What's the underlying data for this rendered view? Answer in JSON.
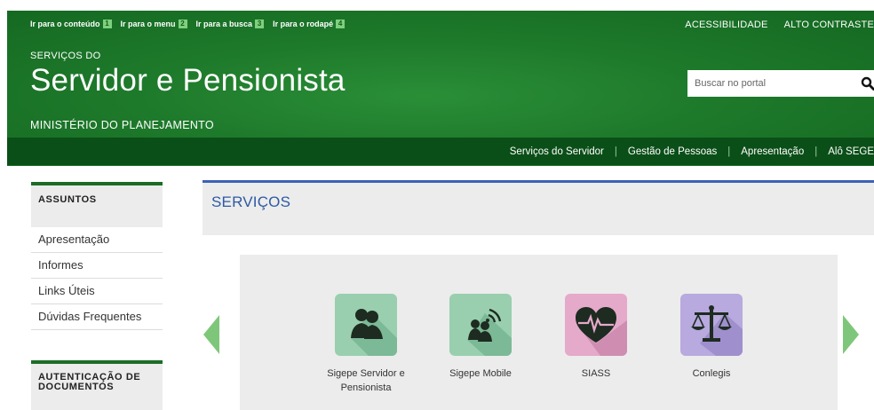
{
  "access_links": [
    {
      "label": "Ir para o conteúdo",
      "num": "1"
    },
    {
      "label": "Ir para o menu",
      "num": "2"
    },
    {
      "label": "Ir para a busca",
      "num": "3"
    },
    {
      "label": "Ir para o rodapé",
      "num": "4"
    }
  ],
  "top_links": {
    "accessibility": "ACESSIBILIDADE",
    "contrast": "ALTO CONTRASTE"
  },
  "brand": {
    "small": "SERVIÇOS DO",
    "title": "Servidor e Pensionista",
    "ministry": "MINISTÉRIO DO PLANEJAMENTO"
  },
  "search": {
    "placeholder": "Buscar no portal",
    "icon": "search-icon"
  },
  "nav": [
    "Serviços do Servidor",
    "Gestão de Pessoas",
    "Apresentação",
    "Alô SEGE"
  ],
  "sidebar": {
    "section1_title": "ASSUNTOS",
    "items": [
      "Apresentação",
      "Informes",
      "Links Úteis",
      "Dúvidas Frequentes"
    ],
    "section2_title": "AUTENTICAÇÃO DE DOCUMENTOS"
  },
  "main": {
    "section_title": "SERVIÇOS",
    "services": [
      {
        "label": "Sigepe Servidor e Pensionista",
        "icon": "users-icon",
        "color": "#99cfae"
      },
      {
        "label": "Sigepe Mobile",
        "icon": "mobile-users-icon",
        "color": "#99cfae"
      },
      {
        "label": "SIASS",
        "icon": "heart-pulse-icon",
        "color": "#e5a9c9"
      },
      {
        "label": "Conlegis",
        "icon": "scales-icon",
        "color": "#b8a9de"
      }
    ]
  },
  "colors": {
    "header_green": "#1e7a2b",
    "nav_green": "#0b4f18",
    "accent_blue": "#2d5aa3",
    "arrow_green": "#7ec77a"
  }
}
